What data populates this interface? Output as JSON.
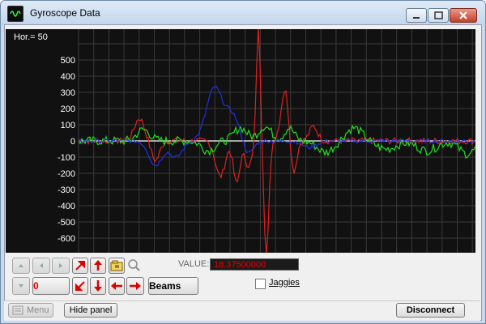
{
  "window": {
    "title": "Gyroscope Data"
  },
  "plot": {
    "hor_label": "Hor.= 50",
    "y_ticks": [
      "500",
      "400",
      "300",
      "200",
      "100",
      "0",
      "-100",
      "-200",
      "-300",
      "-400",
      "-500",
      "-600"
    ]
  },
  "controls": {
    "counter_value": "0",
    "beams_label": "Beams",
    "value_label": "VALUE:",
    "value_text": "18.37500000",
    "jaggies_label": "Jaggies"
  },
  "bottom": {
    "menu_label": "Menu",
    "hide_panel_label": "Hide panel",
    "disconnect_label": "Disconnect"
  },
  "colors": {
    "plot_bg": "#111111",
    "grid": "#3a3a3a",
    "zero_line": "#ffffff",
    "series_red": "#e02020",
    "series_green": "#20e020",
    "series_blue": "#2030e0",
    "value_text": "#e00000"
  },
  "icons": [
    "app-icon",
    "minimize-icon",
    "maximize-icon",
    "close-icon",
    "arrow-up-small-icon",
    "arrow-down-small-icon",
    "arrow-left-small-icon",
    "arrow-right-small-icon",
    "arrow-diag-up-right-icon",
    "arrow-up-icon",
    "arrow-down-icon",
    "arrow-diag-down-left-icon",
    "arrow-left-icon",
    "arrow-right-icon",
    "open-folder-icon",
    "zoom-icon",
    "menu-icon"
  ]
}
